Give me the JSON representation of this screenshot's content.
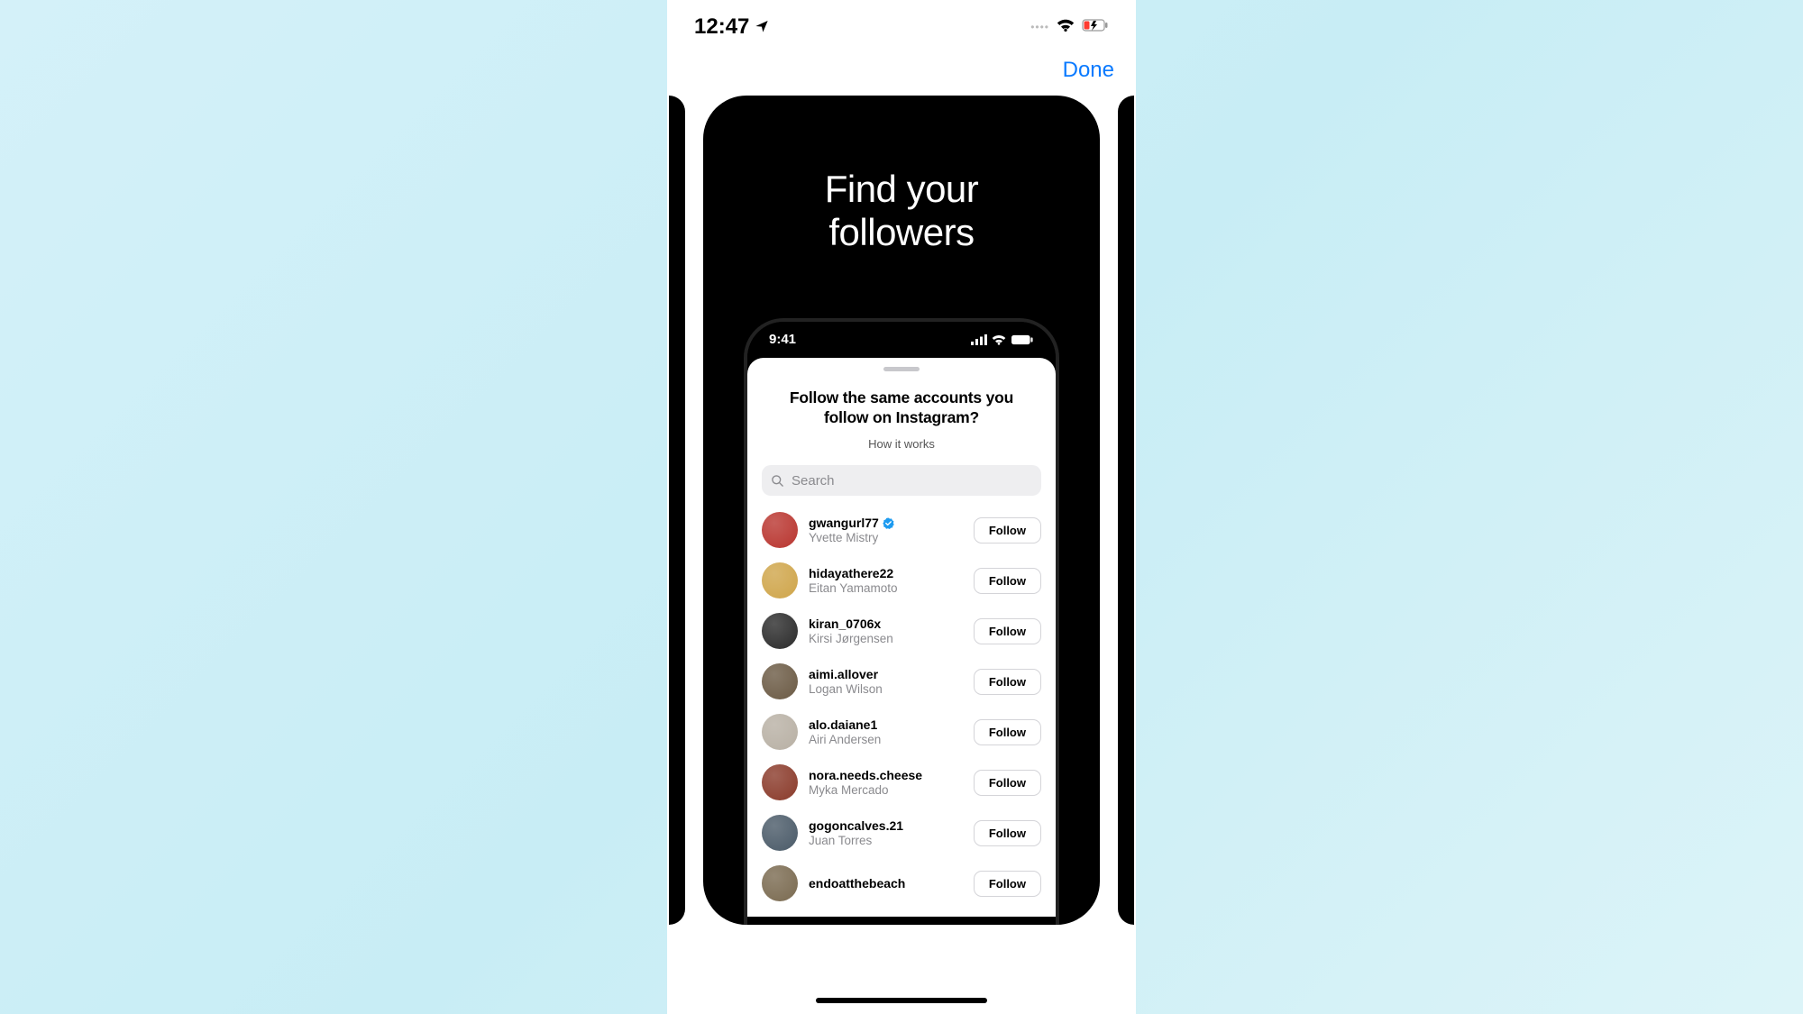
{
  "outer_status": {
    "time": "12:47"
  },
  "nav": {
    "done": "Done"
  },
  "card": {
    "title_line1": "Find your",
    "title_line2": "followers"
  },
  "inner_status": {
    "time": "9:41"
  },
  "sheet": {
    "title": "Follow the same accounts you follow on Instagram?",
    "how_it_works": "How it works",
    "search_placeholder": "Search",
    "follow_label": "Follow"
  },
  "users": [
    {
      "username": "gwangurl77",
      "display": "Yvette Mistry",
      "verified": true,
      "avatar": "#b9352f"
    },
    {
      "username": "hidayathere22",
      "display": "Eitan Yamamoto",
      "verified": false,
      "avatar": "#cfa54a"
    },
    {
      "username": "kiran_0706x",
      "display": "Kirsi Jørgensen",
      "verified": false,
      "avatar": "#2b2b2b"
    },
    {
      "username": "aimi.allover",
      "display": "Logan Wilson",
      "verified": false,
      "avatar": "#6b5a44"
    },
    {
      "username": "alo.daiane1",
      "display": "Airi Andersen",
      "verified": false,
      "avatar": "#b8b0a4"
    },
    {
      "username": "nora.needs.cheese",
      "display": "Myka Mercado",
      "verified": false,
      "avatar": "#8a3a2a"
    },
    {
      "username": "gogoncalves.21",
      "display": "Juan Torres",
      "verified": false,
      "avatar": "#4a5a68"
    },
    {
      "username": "endoatthebeach",
      "display": "",
      "verified": false,
      "avatar": "#7a6a50"
    }
  ]
}
